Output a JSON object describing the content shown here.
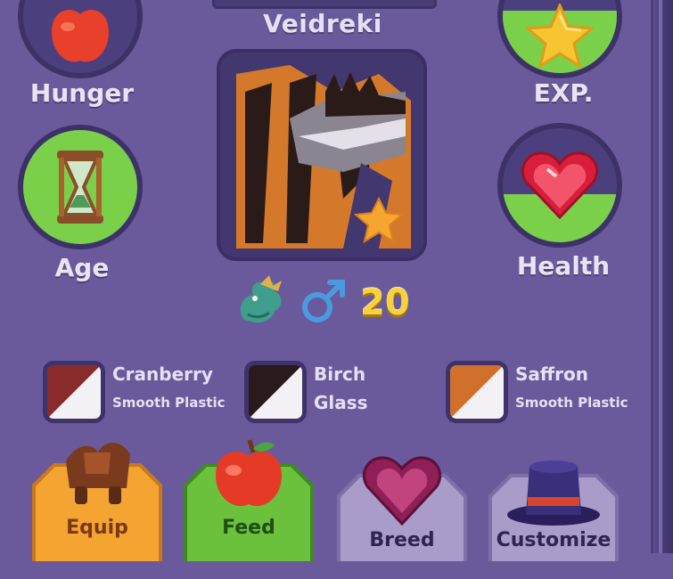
{
  "dragon": {
    "name": "Veidreki",
    "level": "20"
  },
  "stats": {
    "hunger": {
      "label": "Hunger",
      "icon": "apple-icon",
      "fill": 0
    },
    "age": {
      "label": "Age",
      "icon": "hourglass-icon",
      "fill": 1.0
    },
    "exp": {
      "label": "EXP.",
      "icon": "star-icon",
      "fill": 0.55
    },
    "health": {
      "label": "Health",
      "icon": "heart-icon",
      "fill": 0.42
    }
  },
  "info_icons": [
    "dragon-species-icon",
    "male-icon"
  ],
  "colors": [
    {
      "name": "Cranberry",
      "material": "Smooth Plastic",
      "hex": "#8a2b2b"
    },
    {
      "name": "Birch",
      "material": "Glass",
      "hex": "#2b1a1d"
    },
    {
      "name": "Saffron",
      "material": "Smooth Plastic",
      "hex": "#d0702c"
    }
  ],
  "actions": [
    {
      "label": "Equip",
      "icon": "saddle-icon",
      "color": "#f4a431"
    },
    {
      "label": "Feed",
      "icon": "apple-icon",
      "color": "#6cc13c"
    },
    {
      "label": "Breed",
      "icon": "heart-gem-icon",
      "color": "#a99cc9"
    },
    {
      "label": "Customize",
      "icon": "top-hat-icon",
      "color": "#a99cc9"
    }
  ],
  "palette": {
    "background": "#6a5a9c",
    "green": "#7bd04a",
    "gold": "#f7d23a"
  }
}
